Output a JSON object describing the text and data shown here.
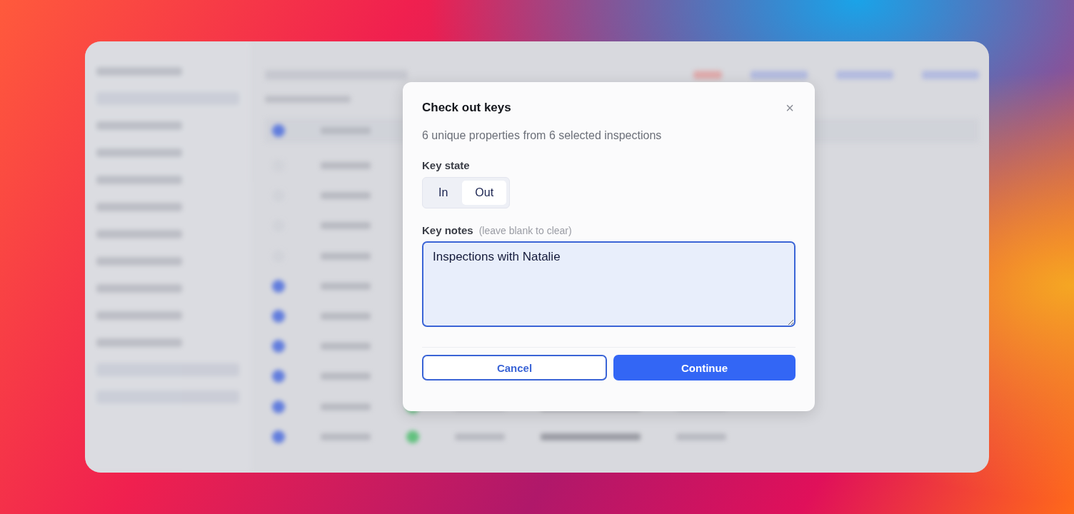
{
  "dialog": {
    "title": "Check out keys",
    "close_icon": "×",
    "summary": "6 unique properties from 6 selected inspections",
    "key_state": {
      "label": "Key state",
      "options": [
        {
          "label": "In",
          "selected": false
        },
        {
          "label": "Out",
          "selected": true
        }
      ]
    },
    "key_notes": {
      "label": "Key notes",
      "hint": "(leave blank to clear)",
      "value": "Inspections with Natalie"
    },
    "buttons": [
      {
        "label": "Cancel",
        "kind": "secondary"
      },
      {
        "label": "Continue",
        "kind": "primary"
      }
    ]
  }
}
